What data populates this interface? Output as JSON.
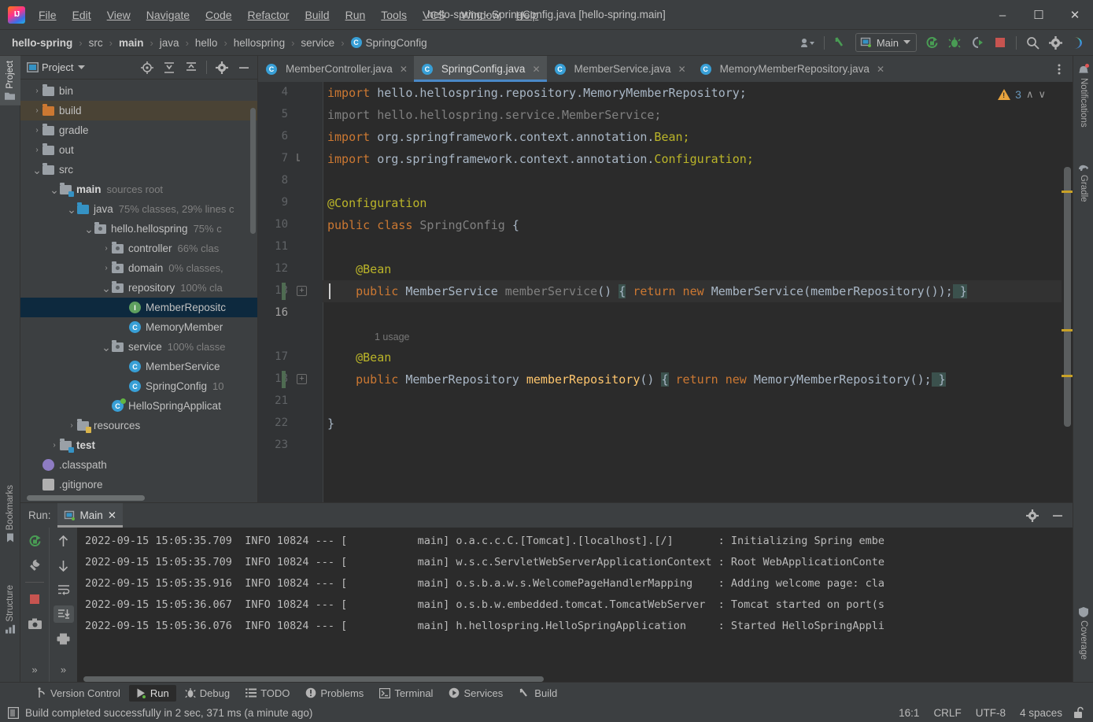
{
  "window": {
    "title": "hello-spring - SpringConfig.java [hello-spring.main]",
    "minimize": "–",
    "maximize": "☐",
    "close": "✕"
  },
  "menubar": {
    "items": [
      "File",
      "Edit",
      "View",
      "Navigate",
      "Code",
      "Refactor",
      "Build",
      "Run",
      "Tools",
      "VCS",
      "Window",
      "Help"
    ]
  },
  "breadcrumb": {
    "separator": "›",
    "items": [
      {
        "label": "hello-spring",
        "bold": true,
        "icon": null
      },
      {
        "label": "src",
        "bold": false,
        "icon": null
      },
      {
        "label": "main",
        "bold": true,
        "icon": null
      },
      {
        "label": "java",
        "bold": false,
        "icon": null
      },
      {
        "label": "hello",
        "bold": false,
        "icon": null
      },
      {
        "label": "hellospring",
        "bold": false,
        "icon": null
      },
      {
        "label": "service",
        "bold": false,
        "icon": null
      },
      {
        "label": "SpringConfig",
        "bold": false,
        "icon": "C"
      }
    ]
  },
  "toolbar": {
    "run_config": "Main",
    "icons": [
      "user-avatar-icon",
      "build-hammer-icon",
      "run-icon",
      "debug-icon",
      "run-coverage-icon",
      "stop-icon",
      "search-everywhere-icon",
      "settings-gear-icon",
      "ide-assistant-icon"
    ]
  },
  "left_strip": {
    "top_tab": "Project",
    "bottom_tabs": [
      "Bookmarks",
      "Structure"
    ]
  },
  "right_strip": {
    "tabs": [
      "Notifications",
      "Gradle",
      "Coverage"
    ]
  },
  "project_panel": {
    "title": "Project",
    "header_icons": [
      "select-opened-file-icon",
      "expand-all-icon",
      "collapse-all-icon",
      "settings-gear-icon",
      "hide-icon"
    ],
    "tree": [
      {
        "depth": 2,
        "arrow": "right",
        "icon": "folder",
        "label": "bin",
        "meta": "",
        "bold": false,
        "state": ""
      },
      {
        "depth": 2,
        "arrow": "right",
        "icon": "folder-orange",
        "label": "build",
        "meta": "",
        "bold": false,
        "state": "sel-build"
      },
      {
        "depth": 2,
        "arrow": "right",
        "icon": "folder",
        "label": "gradle",
        "meta": "",
        "bold": false,
        "state": ""
      },
      {
        "depth": 2,
        "arrow": "right",
        "icon": "folder",
        "label": "out",
        "meta": "",
        "bold": false,
        "state": ""
      },
      {
        "depth": 2,
        "arrow": "down",
        "icon": "folder",
        "label": "src",
        "meta": "",
        "bold": false,
        "state": ""
      },
      {
        "depth": 3,
        "arrow": "down",
        "icon": "folder-source",
        "label": "main",
        "meta": "sources root",
        "bold": true,
        "state": ""
      },
      {
        "depth": 4,
        "arrow": "down",
        "icon": "folder-blue",
        "label": "java",
        "meta": "75% classes, 29% lines c",
        "bold": false,
        "state": ""
      },
      {
        "depth": 5,
        "arrow": "down",
        "icon": "folder-pkg",
        "label": "hello.hellospring",
        "meta": "75% c",
        "bold": false,
        "state": ""
      },
      {
        "depth": 6,
        "arrow": "right",
        "icon": "folder-pkg",
        "label": "controller",
        "meta": "66% clas",
        "bold": false,
        "state": ""
      },
      {
        "depth": 6,
        "arrow": "right",
        "icon": "folder-pkg",
        "label": "domain",
        "meta": "0% classes,",
        "bold": false,
        "state": ""
      },
      {
        "depth": 6,
        "arrow": "down",
        "icon": "folder-pkg",
        "label": "repository",
        "meta": "100% cla",
        "bold": false,
        "state": ""
      },
      {
        "depth": 7,
        "arrow": "none",
        "icon": "interface",
        "label": "MemberRepositc",
        "meta": "",
        "bold": false,
        "state": "sel-file"
      },
      {
        "depth": 7,
        "arrow": "none",
        "icon": "class",
        "label": "MemoryMember",
        "meta": "",
        "bold": false,
        "state": ""
      },
      {
        "depth": 6,
        "arrow": "down",
        "icon": "folder-pkg",
        "label": "service",
        "meta": "100% classe",
        "bold": false,
        "state": ""
      },
      {
        "depth": 7,
        "arrow": "none",
        "icon": "class",
        "label": "MemberService",
        "meta": "",
        "bold": false,
        "state": ""
      },
      {
        "depth": 7,
        "arrow": "none",
        "icon": "class",
        "label": "SpringConfig",
        "meta": "10",
        "bold": false,
        "state": ""
      },
      {
        "depth": 6,
        "arrow": "none",
        "icon": "spring-class",
        "label": "HelloSpringApplicat",
        "meta": "",
        "bold": false,
        "state": ""
      },
      {
        "depth": 4,
        "arrow": "right",
        "icon": "folder-res",
        "label": "resources",
        "meta": "",
        "bold": false,
        "state": ""
      },
      {
        "depth": 3,
        "arrow": "right",
        "icon": "folder-source",
        "label": "test",
        "meta": "",
        "bold": true,
        "state": ""
      },
      {
        "depth": 2,
        "arrow": "none",
        "icon": "file-purple",
        "label": ".classpath",
        "meta": "",
        "bold": false,
        "state": ""
      },
      {
        "depth": 2,
        "arrow": "none",
        "icon": "file-git",
        "label": ".gitignore",
        "meta": "",
        "bold": false,
        "state": ""
      }
    ]
  },
  "editor": {
    "tabs": [
      {
        "label": "MemberController.java",
        "active": false
      },
      {
        "label": "SpringConfig.java",
        "active": true
      },
      {
        "label": "MemberService.java",
        "active": false
      },
      {
        "label": "MemoryMemberRepository.java",
        "active": false
      }
    ],
    "tab_close": "✕",
    "inspection": {
      "count": "3",
      "up": "∧",
      "down": "∨"
    },
    "line_numbers": [
      "4",
      "5",
      "6",
      "7",
      "8",
      "9",
      "10",
      "11",
      "12",
      "13",
      "16",
      "",
      "17",
      "18",
      "21",
      "22",
      "23"
    ],
    "usage_hint": "1 usage",
    "lines": [
      {
        "num": "4",
        "tokens": [
          {
            "t": "import ",
            "c": "kw"
          },
          {
            "t": "hello.hellospring.repository.MemoryMemberRepository;",
            "c": "cls"
          }
        ]
      },
      {
        "num": "5",
        "tokens": [
          {
            "t": "import hello.hellospring.service.MemberService;",
            "c": "dim"
          }
        ]
      },
      {
        "num": "6",
        "tokens": [
          {
            "t": "import ",
            "c": "kw"
          },
          {
            "t": "org.springframework.context.annotation.",
            "c": "cls"
          },
          {
            "t": "Bean;",
            "c": "anno"
          }
        ]
      },
      {
        "num": "7",
        "tokens": [
          {
            "t": "import ",
            "c": "kw"
          },
          {
            "t": "org.springframework.context.annotation.",
            "c": "cls"
          },
          {
            "t": "Configuration;",
            "c": "anno"
          }
        ]
      },
      {
        "num": "8",
        "tokens": []
      },
      {
        "num": "9",
        "tokens": [
          {
            "t": "@Configuration",
            "c": "anno"
          }
        ]
      },
      {
        "num": "10",
        "tokens": [
          {
            "t": "public class ",
            "c": "kw"
          },
          {
            "t": "SpringConfig ",
            "c": "dim"
          },
          {
            "t": "{",
            "c": "cls"
          }
        ]
      },
      {
        "num": "11",
        "tokens": []
      },
      {
        "num": "12",
        "tokens": [
          {
            "t": "    @Bean",
            "c": "anno"
          }
        ]
      },
      {
        "num": "13",
        "tokens": [
          {
            "t": "    public ",
            "c": "kw"
          },
          {
            "t": "MemberService ",
            "c": "cls"
          },
          {
            "t": "memberService",
            "c": "dim"
          },
          {
            "t": "() ",
            "c": "cls"
          },
          {
            "t": "{",
            "c": "hl"
          },
          {
            "t": " ",
            "c": "cls"
          },
          {
            "t": "return new ",
            "c": "kw"
          },
          {
            "t": "MemberService(memberRepository());",
            "c": "cls"
          },
          {
            "t": " }",
            "c": "hl"
          }
        ]
      },
      {
        "num": "16",
        "tokens": []
      },
      {
        "num": "17",
        "tokens": [
          {
            "t": "    @Bean",
            "c": "anno"
          }
        ]
      },
      {
        "num": "18",
        "tokens": [
          {
            "t": "    public ",
            "c": "kw"
          },
          {
            "t": "MemberRepository ",
            "c": "cls"
          },
          {
            "t": "memberRepository",
            "c": "meth"
          },
          {
            "t": "() ",
            "c": "cls"
          },
          {
            "t": "{",
            "c": "hl"
          },
          {
            "t": " ",
            "c": "cls"
          },
          {
            "t": "return new ",
            "c": "kw"
          },
          {
            "t": "MemoryMemberRepository();",
            "c": "cls"
          },
          {
            "t": " }",
            "c": "hl"
          }
        ]
      },
      {
        "num": "21",
        "tokens": []
      },
      {
        "num": "22",
        "tokens": [
          {
            "t": "}",
            "c": "cls"
          }
        ]
      },
      {
        "num": "23",
        "tokens": []
      }
    ]
  },
  "run_panel": {
    "label": "Run:",
    "tab": "Main",
    "tab_close": "✕",
    "header_icons": [
      "settings-gear-icon",
      "hide-panel-icon"
    ],
    "left_tools": [
      "rerun-icon",
      "wrench-settings-icon",
      "stop-icon",
      "camera-snapshot-icon",
      "more-icon"
    ],
    "right_tools": [
      "scroll-up-icon",
      "scroll-down-icon",
      "soft-wrap-icon",
      "scroll-to-end-icon",
      "print-icon",
      "more-icon"
    ],
    "log_lines": [
      {
        "ts": "2022-09-15 15:05:35.709",
        "level": "INFO",
        "pid": "10824",
        "sep": "---",
        "thread": "[           main]",
        "logger": "o.a.c.c.C.[Tomcat].[localhost].[/]       ",
        "msg": ": Initializing Spring embe"
      },
      {
        "ts": "2022-09-15 15:05:35.709",
        "level": "INFO",
        "pid": "10824",
        "sep": "---",
        "thread": "[           main]",
        "logger": "w.s.c.ServletWebServerApplicationContext ",
        "msg": ": Root WebApplicationConte"
      },
      {
        "ts": "2022-09-15 15:05:35.916",
        "level": "INFO",
        "pid": "10824",
        "sep": "---",
        "thread": "[           main]",
        "logger": "o.s.b.a.w.s.WelcomePageHandlerMapping    ",
        "msg": ": Adding welcome page: cla"
      },
      {
        "ts": "2022-09-15 15:05:36.067",
        "level": "INFO",
        "pid": "10824",
        "sep": "---",
        "thread": "[           main]",
        "logger": "o.s.b.w.embedded.tomcat.TomcatWebServer  ",
        "msg": ": Tomcat started on port(s"
      },
      {
        "ts": "2022-09-15 15:05:36.076",
        "level": "INFO",
        "pid": "10824",
        "sep": "---",
        "thread": "[           main]",
        "logger": "h.hellospring.HelloSpringApplication     ",
        "msg": ": Started HelloSpringAppli"
      }
    ]
  },
  "bottom_toolwindows": [
    {
      "label": "Version Control",
      "icon": "branch-icon",
      "active": false
    },
    {
      "label": "Run",
      "icon": "run-icon",
      "active": true
    },
    {
      "label": "Debug",
      "icon": "debug-icon",
      "active": false
    },
    {
      "label": "TODO",
      "icon": "todo-list-icon",
      "active": false
    },
    {
      "label": "Problems",
      "icon": "problems-icon",
      "active": false
    },
    {
      "label": "Terminal",
      "icon": "terminal-icon",
      "active": false
    },
    {
      "label": "Services",
      "icon": "services-icon",
      "active": false
    },
    {
      "label": "Build",
      "icon": "build-hammer-icon",
      "active": false
    }
  ],
  "status_bar": {
    "message": "Build completed successfully in 2 sec, 371 ms (a minute ago)",
    "caret_position": "16:1",
    "line_separator": "CRLF",
    "encoding": "UTF-8",
    "indent": "4 spaces",
    "lock_icon": "unlocked-icon"
  },
  "colors": {
    "bg_panel": "#3c3f41",
    "bg_editor": "#2b2b2b",
    "accent_blue": "#4a88c7",
    "keyword_orange": "#cc7832",
    "annotation_yellow": "#bbb529",
    "method_yellow": "#ffc66d",
    "text_default": "#a9b7c6",
    "selection_blue": "#0d293e",
    "selection_build": "#4a4335",
    "warning_yellow": "#e8a33d",
    "green_run": "#499c54",
    "red_stop": "#c75450"
  }
}
